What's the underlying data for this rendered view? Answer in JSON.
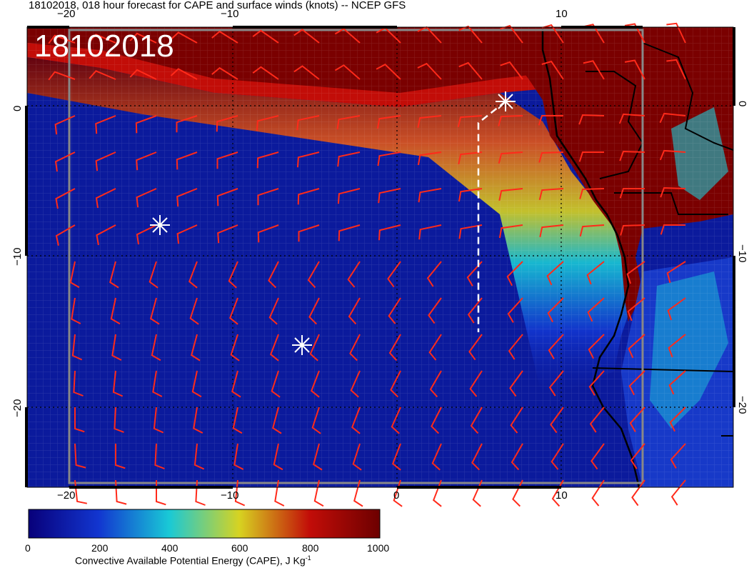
{
  "title": "18102018, 018 hour forecast for CAPE and surface winds (knots) -- NCEP GFS",
  "date_stamp": "18102018",
  "lon_ticks": [
    "−20",
    "−10",
    "0",
    "10"
  ],
  "lat_ticks": [
    "0",
    "−10",
    "−20"
  ],
  "colorbar": {
    "labels": [
      "0",
      "200",
      "400",
      "600",
      "800",
      "1000"
    ],
    "title_main": "Convective Available Potential Energy (CAPE), J Kg",
    "title_sup": "-1",
    "stops": [
      "#08007a",
      "#1236d0",
      "#19c9d6",
      "#d7d321",
      "#c20d08",
      "#6d0000"
    ]
  },
  "colors": {
    "ocean": "#0b1a9c",
    "land": "#7a0000",
    "barb": "#ff2a1a",
    "coast": "#000000",
    "marker": "#ffffff"
  },
  "markers": [
    "asterisk-marker",
    "asterisk-marker",
    "asterisk-marker"
  ],
  "wind_barbs_dir_deg": 150
}
